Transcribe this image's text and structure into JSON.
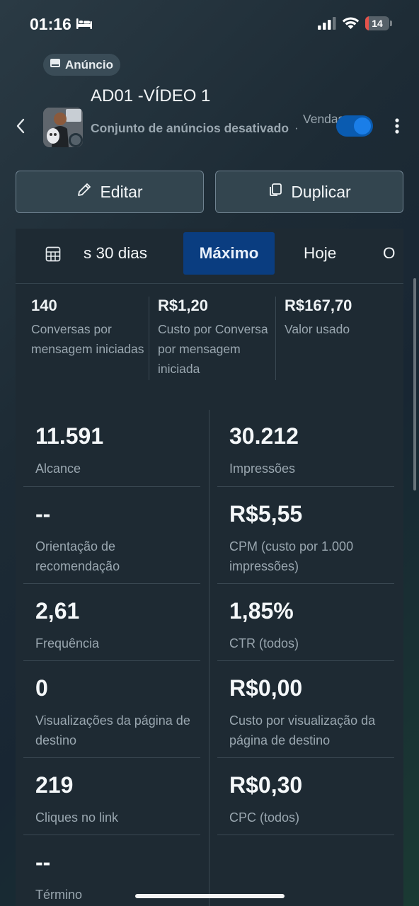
{
  "status_bar": {
    "time": "01:16",
    "battery_level": "14",
    "battery_percent": 14,
    "battery_color": "#e5534b"
  },
  "header": {
    "type_label": "Anúncio",
    "title": "AD01 -VÍDEO 1",
    "adset_status": "Conjunto de anúncios desativado",
    "separator": "·",
    "objective": "Vendas"
  },
  "actions": {
    "edit_label": "Editar",
    "duplicate_label": "Duplicar"
  },
  "date_tabs": {
    "tabs": [
      "s 30 dias",
      "Máximo",
      "Hoje",
      "O"
    ],
    "selected": "Máximo"
  },
  "summary": [
    {
      "value": "140",
      "label": "Conversas por mensagem iniciadas"
    },
    {
      "value": "R$1,20",
      "label": "Custo por Conversa por mensagem iniciada"
    },
    {
      "value": "R$167,70",
      "label": "Valor usado"
    }
  ],
  "metrics": {
    "left": [
      {
        "value": "11.591",
        "label": "Alcance"
      },
      {
        "value": "--",
        "label": "Orientação de recomendação"
      },
      {
        "value": "2,61",
        "label": "Frequência"
      },
      {
        "value": "0",
        "label": "Visualizações da página de destino"
      },
      {
        "value": "219",
        "label": "Cliques no link"
      },
      {
        "value": "--",
        "label": "Término"
      }
    ],
    "right": [
      {
        "value": "30.212",
        "label": "Impressões"
      },
      {
        "value": "R$5,55",
        "label": "CPM (custo por 1.000 impressões)"
      },
      {
        "value": "1,85%",
        "label": "CTR (todos)"
      },
      {
        "value": "R$0,00",
        "label": "Custo por visualização da página de destino"
      },
      {
        "value": "R$0,30",
        "label": "CPC (todos)"
      }
    ]
  },
  "colors": {
    "accent": "#0a3d80",
    "toggle_on": "#1a7ee8"
  }
}
